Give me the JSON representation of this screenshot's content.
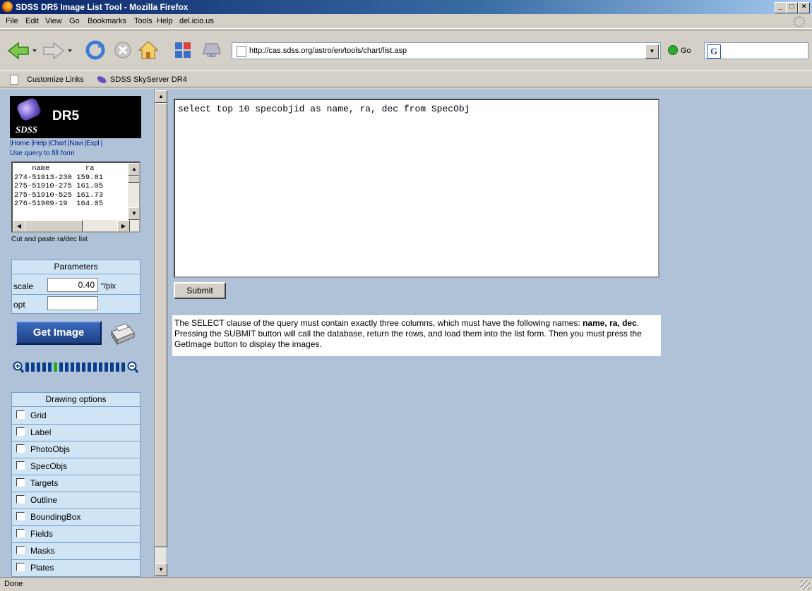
{
  "window": {
    "title": "SDSS DR5 Image List Tool - Mozilla Firefox"
  },
  "menu": {
    "file": "File",
    "edit": "Edit",
    "view": "View",
    "go": "Go",
    "bookmarks": "Bookmarks",
    "tools": "Tools",
    "help": "Help",
    "delicious": "del.icio.us"
  },
  "toolbar": {
    "url": "http://cas.sdss.org/astro/en/tools/chart/list.asp",
    "go_label": "Go",
    "tag_label": "TAG",
    "search_logo": "G"
  },
  "bookmarks": {
    "customize": "Customize Links",
    "skyserver": "SDSS SkyServer DR4"
  },
  "sidebar": {
    "logo_title": "DR5",
    "logo_sdss": "SDSS",
    "nav_links": "|Home |Help |Chart |Navi |Expl |",
    "fill_hint": "Use query to fill form",
    "list_header": "    name        ra",
    "list_rows": [
      "274-51913-230 159.81",
      "275-51910-275 161.05",
      "275-51910-525 161.73",
      "276-51909-19  164.05"
    ],
    "paste_hint": "Cut and paste ra/dec list",
    "params": {
      "header": "Parameters",
      "scale_label": "scale",
      "scale_value": "0.40",
      "scale_unit": "\"/pix",
      "opt_label": "opt",
      "opt_value": ""
    },
    "get_image": "Get Image",
    "drawing": {
      "header": "Drawing options",
      "options": [
        "Grid",
        "Label",
        "PhotoObjs",
        "SpecObjs",
        "Targets",
        "Outline",
        "BoundingBox",
        "Fields",
        "Masks",
        "Plates"
      ]
    }
  },
  "main": {
    "query": "select top 10 specobjid as name, ra, dec from SpecObj",
    "submit": "Submit",
    "desc_pre": "The SELECT clause of the query must contain exactly three columns, which must have the following names: ",
    "desc_bold": "name, ra, dec",
    "desc_post": ". Pressing the SUBMIT button will call the database, return the rows, and load them into the list form. Then you must press the GetImage button to display the images."
  },
  "status": {
    "text": "Done"
  },
  "colors": {
    "content_bg": "#afc2d8",
    "panel_bg": "#cfe4f4",
    "title_bar": "#0a246a",
    "button_blue": "#1c3c80"
  }
}
